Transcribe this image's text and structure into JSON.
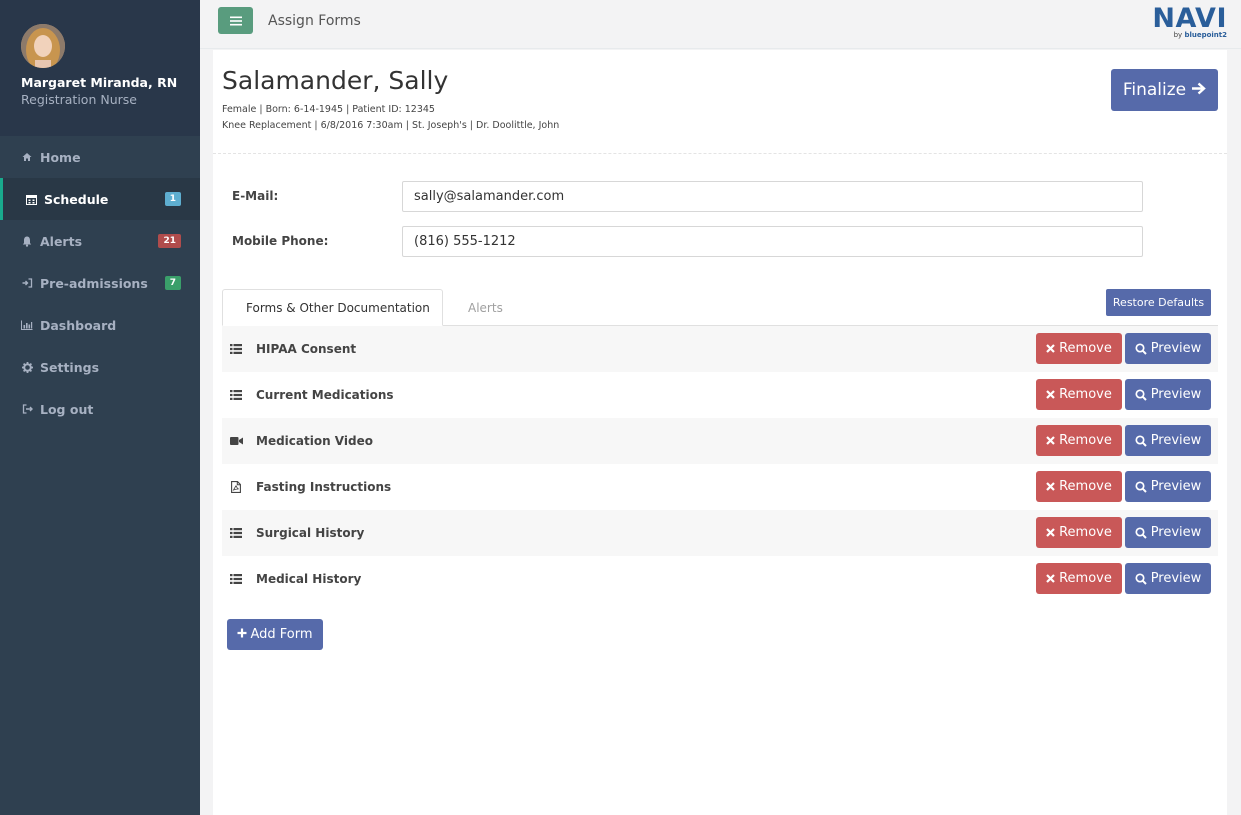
{
  "header": {
    "page_title": "Assign Forms",
    "logo_main": "NAVI",
    "logo_by": "by",
    "logo_brand": "bluepoint2"
  },
  "user": {
    "name": "Margaret Miranda, RN",
    "role": "Registration Nurse"
  },
  "nav": [
    {
      "label": "Home",
      "icon": "home-icon",
      "badge": null
    },
    {
      "label": "Schedule",
      "icon": "calendar-icon",
      "badge": "1",
      "active": true
    },
    {
      "label": "Alerts",
      "icon": "bell-icon",
      "badge": "21"
    },
    {
      "label": "Pre-admissions",
      "icon": "sign-in-icon",
      "badge": "7"
    },
    {
      "label": "Dashboard",
      "icon": "bar-chart-icon",
      "badge": null
    },
    {
      "label": "Settings",
      "icon": "gear-icon",
      "badge": null
    },
    {
      "label": "Log out",
      "icon": "sign-out-icon",
      "badge": null
    }
  ],
  "patient": {
    "name": "Salamander, Sally",
    "details_line1": "Female | Born: 6-14-1945 | Patient ID: 12345",
    "details_line2": "Knee Replacement | 6/8/2016 7:30am | St. Joseph's | Dr. Doolittle, John"
  },
  "finalize_label": "Finalize",
  "fields": {
    "email_label": "E-Mail:",
    "email_value": "sally@salamander.com",
    "phone_label": "Mobile Phone:",
    "phone_value": "(816) 555-1212"
  },
  "tabs": [
    {
      "label": "Forms & Other Documentation",
      "active": true
    },
    {
      "label": "Alerts",
      "active": false
    }
  ],
  "restore_label": "Restore Defaults",
  "forms": [
    {
      "label": "HIPAA Consent",
      "icon": "list-icon"
    },
    {
      "label": "Current Medications",
      "icon": "list-icon"
    },
    {
      "label": "Medication Video",
      "icon": "video-camera-icon"
    },
    {
      "label": "Fasting Instructions",
      "icon": "pdf-file-icon"
    },
    {
      "label": "Surgical History",
      "icon": "list-icon"
    },
    {
      "label": "Medical History",
      "icon": "list-icon"
    }
  ],
  "row_actions": {
    "remove_label": "Remove",
    "preview_label": "Preview"
  },
  "add_form_label": "Add Form",
  "colors": {
    "sidebar": "#2f4050",
    "primary_button": "#566aaa",
    "danger_button": "#c95858",
    "menu_button": "#599c7e",
    "logo": "#2a5e9a"
  }
}
